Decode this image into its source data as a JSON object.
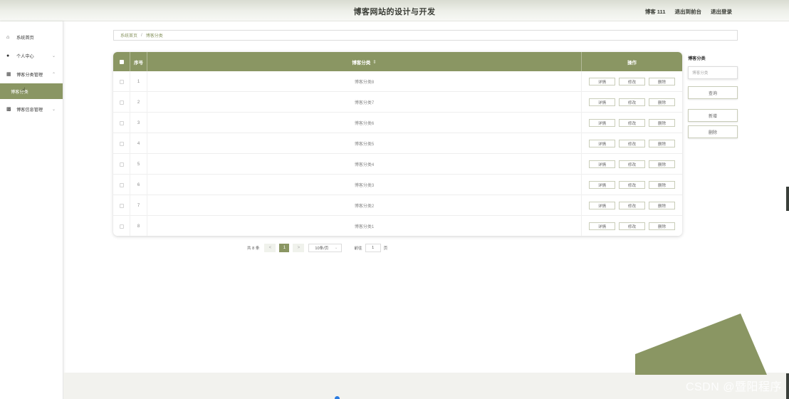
{
  "header": {
    "site_title": "博客网站的设计与开发",
    "user_label": "博客 111",
    "to_frontend": "退出到前台",
    "logout": "退出登录"
  },
  "sidebar": {
    "items": [
      {
        "label": "系统首页",
        "icon": "home-icon"
      },
      {
        "label": "个人中心",
        "icon": "user-icon"
      },
      {
        "label": "博客分类管理",
        "icon": "grid-icon"
      },
      {
        "label": "博客信息管理",
        "icon": "apps-icon"
      }
    ],
    "sub_active": "博客分类"
  },
  "breadcrumb": {
    "home": "系统首页",
    "separator": "/",
    "current": "博客分类"
  },
  "table": {
    "headers": {
      "index": "序号",
      "name": "博客分类",
      "sort_icon": "⇕",
      "ops": "操作"
    },
    "rows": [
      {
        "index": "1",
        "name": "博客分类8"
      },
      {
        "index": "2",
        "name": "博客分类7"
      },
      {
        "index": "3",
        "name": "博客分类6"
      },
      {
        "index": "4",
        "name": "博客分类5"
      },
      {
        "index": "5",
        "name": "博客分类4"
      },
      {
        "index": "6",
        "name": "博客分类3"
      },
      {
        "index": "7",
        "name": "博客分类2"
      },
      {
        "index": "8",
        "name": "博客分类1"
      }
    ],
    "actions": {
      "detail": "详情",
      "edit": "修改",
      "delete": "删除"
    }
  },
  "pagination": {
    "total": "共 8 条",
    "prev": "<",
    "current_page": "1",
    "next": ">",
    "page_size": "10条/页",
    "goto_label": "前往",
    "goto_value": "1",
    "page_suffix": "页"
  },
  "search_panel": {
    "label": "博客分类",
    "placeholder": "博客分类",
    "query_button": "查询",
    "add_button": "新增",
    "delete_button": "删除"
  },
  "watermark": "CSDN @暨阳程序",
  "colors": {
    "accent": "#8a9663"
  }
}
